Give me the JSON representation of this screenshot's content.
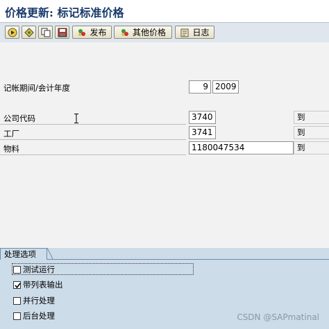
{
  "window": {
    "title": "价格更新: 标记标准价格"
  },
  "toolbar": {
    "buttons": [
      {
        "icon": "execute-icon"
      },
      {
        "icon": "variants-icon"
      },
      {
        "icon": "copy-icon"
      },
      {
        "icon": "save-variant-icon"
      },
      {
        "icon": "release-icon",
        "label": "发布"
      },
      {
        "icon": "other-prices-icon",
        "label": "其他价格"
      },
      {
        "icon": "log-icon",
        "label": "日志"
      }
    ]
  },
  "fields": {
    "period": {
      "label": "记帐期间/会计年度",
      "month": "9",
      "year": "2009"
    },
    "company_code": {
      "label": "公司代码",
      "value": "3740",
      "to": "到"
    },
    "plant": {
      "label": "工厂",
      "value": "3741",
      "to": "到"
    },
    "material": {
      "label": "物料",
      "value": "1180047534",
      "to": "到"
    }
  },
  "processing": {
    "tab_label": "处理选项",
    "options": [
      {
        "label": "测试运行",
        "checked": false
      },
      {
        "label": "带列表输出",
        "checked": true
      },
      {
        "label": "并行处理",
        "checked": false
      },
      {
        "label": "后台处理",
        "checked": false
      }
    ]
  },
  "watermark": "CSDN @SAPmatinal"
}
